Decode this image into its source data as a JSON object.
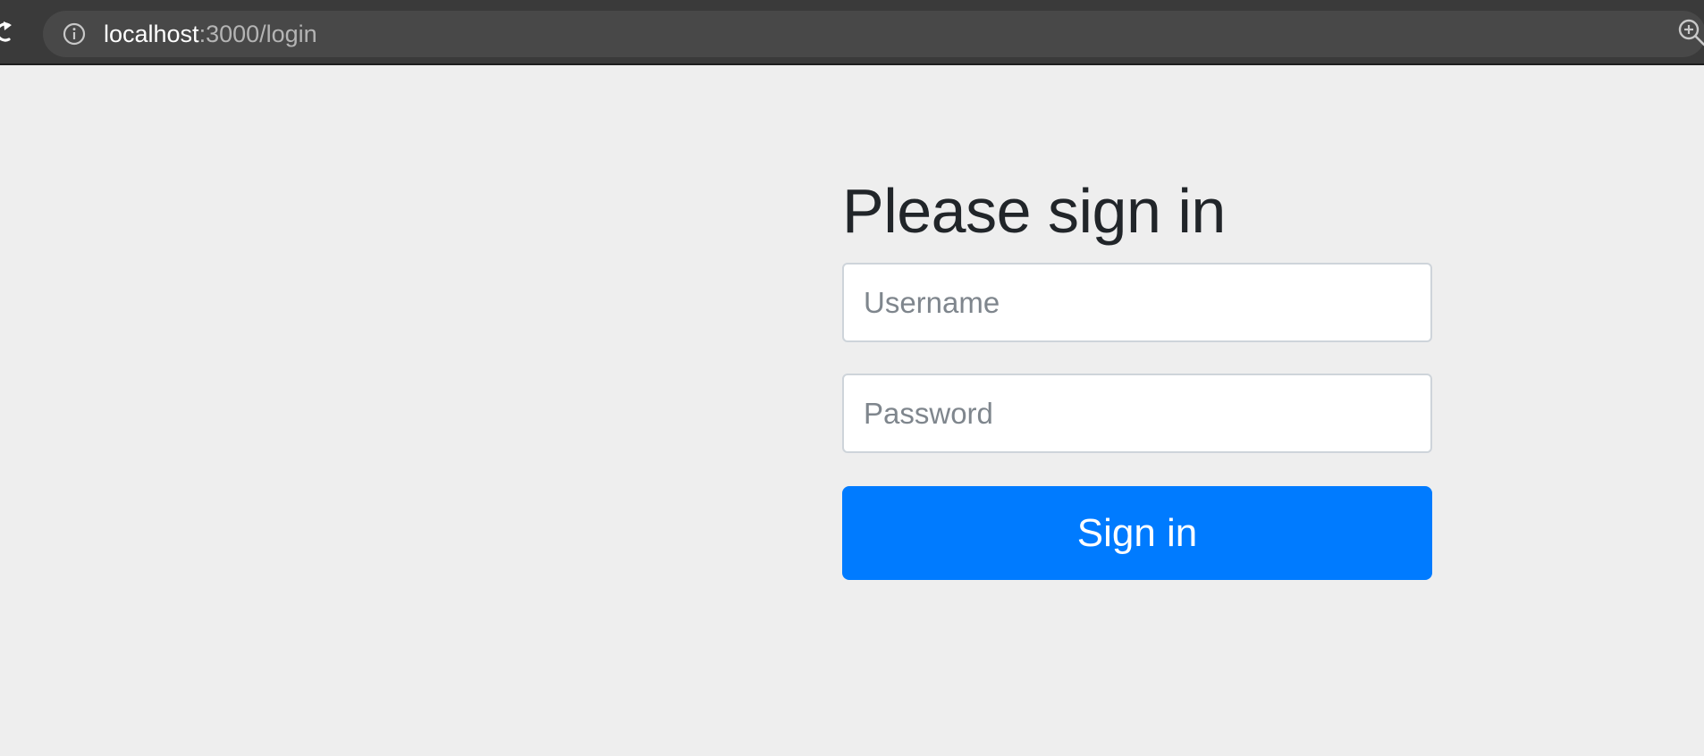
{
  "browser": {
    "url_host": "localhost",
    "url_path": ":3000/login",
    "icons": {
      "reload": "reload-icon",
      "info": "info-icon",
      "zoom": "zoom-icon"
    }
  },
  "login": {
    "heading": "Please sign in",
    "username_placeholder": "Username",
    "username_value": "",
    "password_placeholder": "Password",
    "password_value": "",
    "submit_label": "Sign in"
  },
  "colors": {
    "page_background": "#eeeeee",
    "primary_button": "#007bff",
    "heading_text": "#212529",
    "toolbar": "#3a3a3a"
  }
}
